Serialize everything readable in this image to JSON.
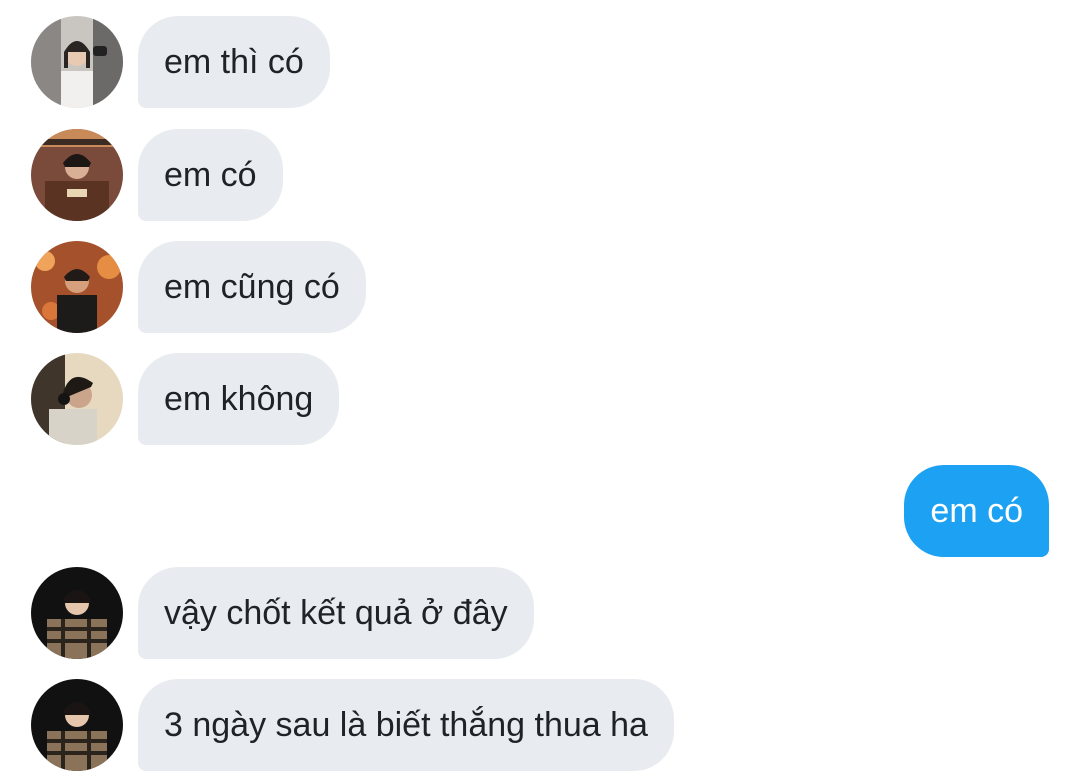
{
  "conversation": {
    "messages": [
      {
        "sender": "other",
        "text": "em thì có",
        "avatar": "avatar-girl-white-shirt"
      },
      {
        "sender": "other",
        "text": "em có",
        "avatar": "avatar-boy-brown-jacket"
      },
      {
        "sender": "other",
        "text": "em cũng có",
        "avatar": "avatar-boy-warm-lights"
      },
      {
        "sender": "other",
        "text": "em không",
        "avatar": "avatar-boy-headphones"
      },
      {
        "sender": "self",
        "text": "em có"
      },
      {
        "sender": "other",
        "text": "vậy chốt kết quả ở đây",
        "avatar": "avatar-boy-plaid-shirt"
      },
      {
        "sender": "other",
        "text": "3 ngày sau là biết thắng thua ha",
        "avatar": "avatar-boy-plaid-shirt"
      }
    ]
  },
  "colors": {
    "incoming_bubble": "#e8ecf0",
    "incoming_text": "#1f2226",
    "outgoing_bubble": "#1da1f2",
    "outgoing_text": "#ffffff",
    "background": "#ffffff"
  }
}
